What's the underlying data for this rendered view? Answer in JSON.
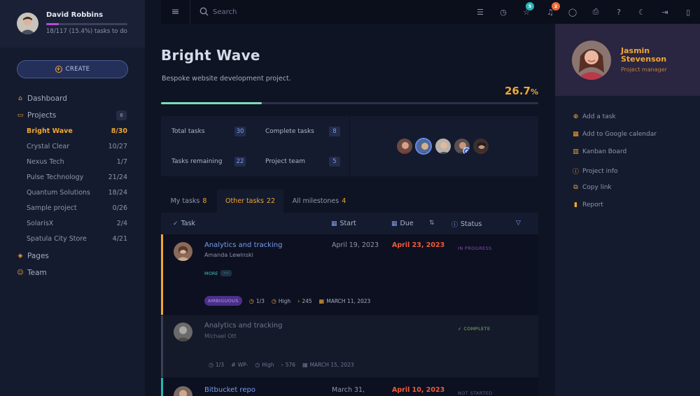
{
  "user": {
    "name": "David Robbins",
    "progress_text": "18/117 (15.4%) tasks to do",
    "progress_fraction": 0.154
  },
  "create_button": {
    "label": "CREATE"
  },
  "nav": {
    "dashboard": "Dashboard",
    "projects": "Projects",
    "projects_count": "8",
    "pages": "Pages",
    "team": "Team"
  },
  "projects": [
    {
      "name": "Bright Wave",
      "count": "8/30",
      "active": true
    },
    {
      "name": "Crystal Clear",
      "count": "10/27"
    },
    {
      "name": "Nexus Tech",
      "count": "1/7"
    },
    {
      "name": "Pulse Technology",
      "count": "21/24"
    },
    {
      "name": "Quantum Solutions",
      "count": "18/24"
    },
    {
      "name": "Sample project",
      "count": "0/26"
    },
    {
      "name": "SolarisX",
      "count": "2/4"
    },
    {
      "name": "Spatula City Store",
      "count": "4/21"
    }
  ],
  "topbar": {
    "search_placeholder": "Search",
    "star_badge": "5",
    "bell_badge": "2",
    "colors": {
      "star_badge": "#2ab5b5",
      "bell_badge": "#f06a3a"
    }
  },
  "project": {
    "title": "Bright Wave",
    "description": "Bespoke website development project.",
    "percent_value": "26.7",
    "percent_sign": "%",
    "progress_fraction": 0.267
  },
  "stats": {
    "total_label": "Total tasks",
    "total": "30",
    "complete_label": "Complete tasks",
    "complete": "8",
    "remaining_label": "Tasks remaining",
    "remaining": "22",
    "team_label": "Project team",
    "team": "5"
  },
  "tabs": [
    {
      "label": "My tasks",
      "count": "8"
    },
    {
      "label": "Other tasks",
      "count": "22",
      "active": true
    },
    {
      "label": "All milestones",
      "count": "4"
    }
  ],
  "table_headers": {
    "task": "Task",
    "start": "Start",
    "due": "Due",
    "status": "Status"
  },
  "tasks": [
    {
      "title": "Analytics and tracking",
      "person": "Amanda Lewinski",
      "start": "April 19, 2023",
      "due": "April 23, 2023",
      "status": "IN PROGRESS",
      "more": "MORE",
      "more_dots": "···",
      "tag": "AMBIGUOUS",
      "subtasks": "1/3",
      "priority": "High",
      "points": "245",
      "date": "MARCH 11, 2023"
    },
    {
      "title": "Analytics and tracking",
      "person": "Michael Ott",
      "status": "COMPLETE",
      "subtasks": "1/3",
      "tag": "WP-",
      "priority": "High",
      "points": "576",
      "date": "MARCH 15, 2023"
    },
    {
      "title": "Bitbucket repo",
      "start": "March 31,",
      "due": "April 10, 2023",
      "status": "NOT STARTED"
    }
  ],
  "project_manager": {
    "first_name": "Jasmin",
    "last_name": "Stevenson",
    "role": "Project manager"
  },
  "actions": [
    {
      "label": "Add a task",
      "icon": "plus-circle-icon"
    },
    {
      "label": "Add to Google calendar",
      "icon": "calendar-icon"
    },
    {
      "label": "Kanban Board",
      "icon": "kanban-icon"
    },
    {
      "label": "Project info",
      "icon": "info-icon"
    },
    {
      "label": "Copy link",
      "icon": "copy-icon"
    },
    {
      "label": "Report",
      "icon": "chart-icon"
    }
  ]
}
